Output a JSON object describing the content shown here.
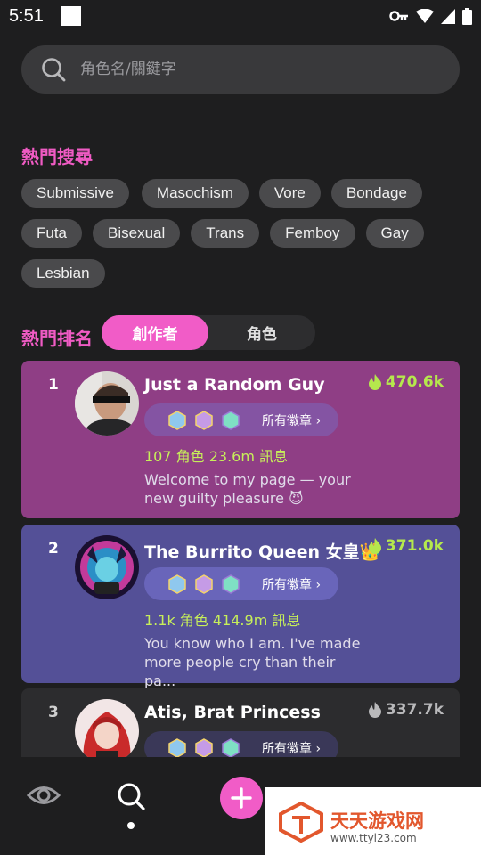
{
  "status_bar": {
    "time": "5:51"
  },
  "search": {
    "placeholder": "角色名/關鍵字"
  },
  "hot_search": {
    "title": "熱門搜尋",
    "tags": [
      "Submissive",
      "Masochism",
      "Vore",
      "Bondage",
      "Futa",
      "Bisexual",
      "Trans",
      "Femboy",
      "Gay",
      "Lesbian"
    ]
  },
  "ranking": {
    "title": "熱門排名",
    "tabs": [
      {
        "label": "創作者",
        "active": true
      },
      {
        "label": "角色",
        "active": false
      }
    ],
    "cards": [
      {
        "rank": "1",
        "name": "Just  a Random Guy",
        "heat": "470.6k",
        "badges_label": "所有徽章 ›",
        "stats": "107 角色 23.6m 訊息",
        "bio_line1": "Welcome to my page — your",
        "bio_line2": "new guilty pleasure 😈",
        "bg": "#8f3e85"
      },
      {
        "rank": "2",
        "name": "The Burrito Queen 女皇👑",
        "heat": "371.0k",
        "badges_label": "所有徽章 ›",
        "stats": "1.1k 角色 414.9m 訊息",
        "bio_line1": "You know who I am. I've made",
        "bio_line2": "more people cry than their pa...",
        "bg": "#545097"
      },
      {
        "rank": "3",
        "name": "Atis, Brat Princess",
        "heat": "337.7k",
        "badges_label": "所有徽章 ›",
        "bg": "#2c2c2e"
      }
    ]
  },
  "watermark": {
    "title": "天天游戏网",
    "url": "www.ttyl23.com"
  },
  "colors": {
    "accent": "#f15cc7",
    "stats": "#c7ef5a",
    "heat_green": "#b5e84d"
  }
}
